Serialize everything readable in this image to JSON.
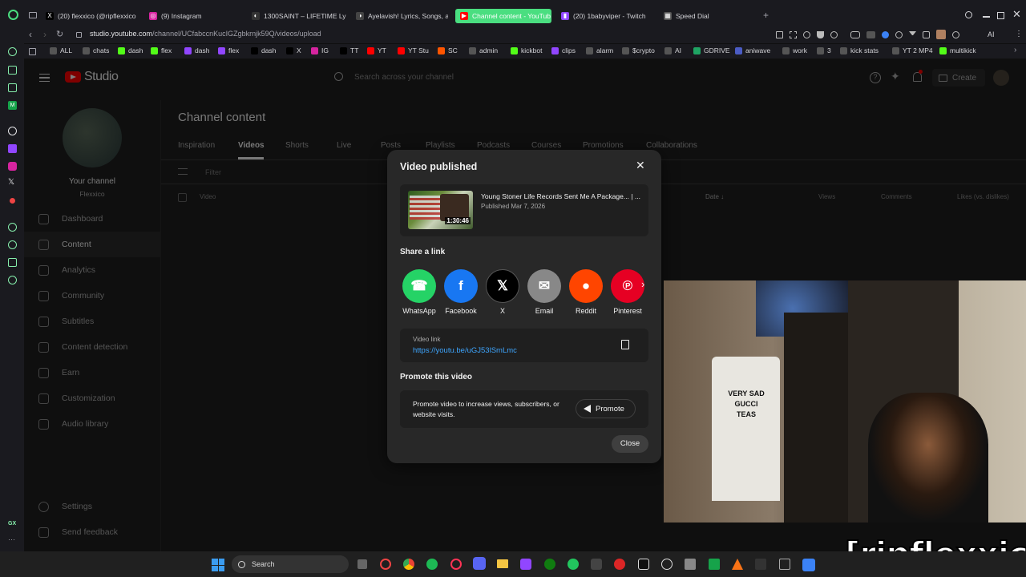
{
  "browser": {
    "tabs": [
      {
        "label": "(20) flexxico (@ripflexxico",
        "color": "#000000",
        "glyph": "X"
      },
      {
        "label": "(9) Instagram",
        "color": "#d6249f",
        "glyph": "◎"
      },
      {
        "label": "1300SAINT – LIFETIME Ly",
        "color": "#333333",
        "glyph": "◐"
      },
      {
        "label": "Ayelavish! Lyrics, Songs, a",
        "color": "#444444",
        "glyph": "◑"
      },
      {
        "label": "Channel content - YouTub",
        "color": "#ff0000",
        "glyph": "▶"
      },
      {
        "label": "(20) 1babyviper - Twitch",
        "color": "#9146ff",
        "glyph": "▮"
      },
      {
        "label": "Speed Dial",
        "color": "#555555",
        "glyph": "▦"
      }
    ],
    "url_prefix": "studio.youtube.com",
    "url_path": "/channel/UCfabccnKucIGZgbkrnjk59Q/videos/upload",
    "bookmarks": [
      {
        "label": "ALL",
        "color": "#555555"
      },
      {
        "label": "chats",
        "color": "#555555"
      },
      {
        "label": "dash",
        "color": "#53fc18"
      },
      {
        "label": "flex",
        "color": "#53fc18"
      },
      {
        "label": "dash",
        "color": "#9146ff"
      },
      {
        "label": "flex",
        "color": "#9146ff"
      },
      {
        "label": "dash",
        "color": "#000000"
      },
      {
        "label": "X",
        "color": "#000000"
      },
      {
        "label": "IG",
        "color": "#d6249f"
      },
      {
        "label": "TT",
        "color": "#000000"
      },
      {
        "label": "YT",
        "color": "#ff0000"
      },
      {
        "label": "YT Stu",
        "color": "#ff0000"
      },
      {
        "label": "SC",
        "color": "#ff5500"
      },
      {
        "label": "admin",
        "color": "#555555"
      },
      {
        "label": "kickbot",
        "color": "#53fc18"
      },
      {
        "label": "clips",
        "color": "#9146ff"
      },
      {
        "label": "alarm",
        "color": "#555555"
      },
      {
        "label": "$crypto",
        "color": "#555555"
      },
      {
        "label": "AI",
        "color": "#555555"
      },
      {
        "label": "GDRIVE",
        "color": "#1fa463"
      },
      {
        "label": "aniwave",
        "color": "#4b5cc4"
      },
      {
        "label": "work",
        "color": "#555555"
      },
      {
        "label": "3",
        "color": "#555555"
      },
      {
        "label": "kick stats",
        "color": "#555555"
      },
      {
        "label": "YT 2 MP4",
        "color": "#555555"
      },
      {
        "label": "multikick",
        "color": "#53fc18"
      }
    ],
    "ext_ai_label": "AI"
  },
  "studio": {
    "logo_text": "Studio",
    "search_placeholder": "Search across your channel",
    "create_label": "Create",
    "channel_label": "Your channel",
    "channel_name": "Flexxico",
    "page_title": "Channel content",
    "tabs": [
      "Inspiration",
      "Videos",
      "Shorts",
      "Live",
      "Posts",
      "Playlists",
      "Podcasts",
      "Courses",
      "Promotions",
      "Collaborations"
    ],
    "filter_label": "Filter",
    "table_headers": {
      "video": "Video",
      "date": "Date ↓",
      "views": "Views",
      "comments": "Comments",
      "likes": "Likes (vs. dislikes)"
    },
    "nav": [
      "Dashboard",
      "Content",
      "Analytics",
      "Community",
      "Subtitles",
      "Content detection",
      "Earn",
      "Customization",
      "Audio library"
    ],
    "settings_label": "Settings",
    "feedback_label": "Send feedback"
  },
  "dialog": {
    "title": "Video published",
    "video_title": "Young Stoner Life Records Sent Me A Package... | ...",
    "published": "Published Mar 7, 2026",
    "duration": "1:30:46",
    "share_heading": "Share a link",
    "share": [
      {
        "label": "WhatsApp",
        "color": "#25d366"
      },
      {
        "label": "Facebook",
        "color": "#1877f2"
      },
      {
        "label": "X",
        "color": "#000000"
      },
      {
        "label": "Email",
        "color": "#888888"
      },
      {
        "label": "Reddit",
        "color": "#ff4500"
      },
      {
        "label": "Pinterest",
        "color": "#e60023"
      }
    ],
    "link_label": "Video link",
    "link_url": "https://youtu.be/uGJ53lSmLmc",
    "promote_heading": "Promote this video",
    "promote_text": "Promote video to increase views, subscribers, or website visits.",
    "promote_button": "Promote",
    "close_button": "Close"
  },
  "overlay_text": "[ripflexxico]",
  "taskbar": {
    "search_label": "Search"
  },
  "colors": {
    "accent_link": "#3ea6ff",
    "brand_red": "#ff0000",
    "browser_accent": "#4ade80"
  }
}
